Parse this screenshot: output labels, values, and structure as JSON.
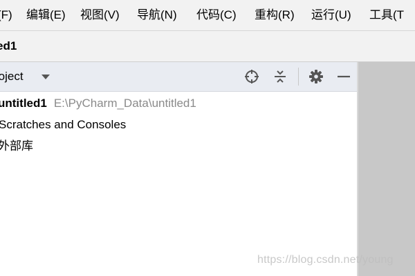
{
  "menubar": {
    "items": [
      {
        "label": "(F)"
      },
      {
        "label": "编辑(E)"
      },
      {
        "label": "视图(V)"
      },
      {
        "label": "导航(N)"
      },
      {
        "label": "代码(C)"
      },
      {
        "label": "重构(R)"
      },
      {
        "label": "运行(U)"
      },
      {
        "label": "工具(T"
      }
    ]
  },
  "titlebar": {
    "project_name": "ed1"
  },
  "project_panel": {
    "title": "roject",
    "icons": [
      "locate-icon",
      "collapse-all-icon",
      "gear-icon",
      "minimize-icon"
    ],
    "tree": [
      {
        "name": "untitled1",
        "path": "E:\\PyCharm_Data\\untitled1"
      },
      {
        "name": "Scratches and Consoles"
      },
      {
        "name": "外部库"
      }
    ]
  },
  "watermark": "https://blog.csdn.net/young",
  "colors": {
    "menubar_bg": "#f2f2f2",
    "header_bg": "#e9ecf2",
    "path_gray": "#8a8a8a",
    "right_panel_bg": "#c8c8c8"
  }
}
